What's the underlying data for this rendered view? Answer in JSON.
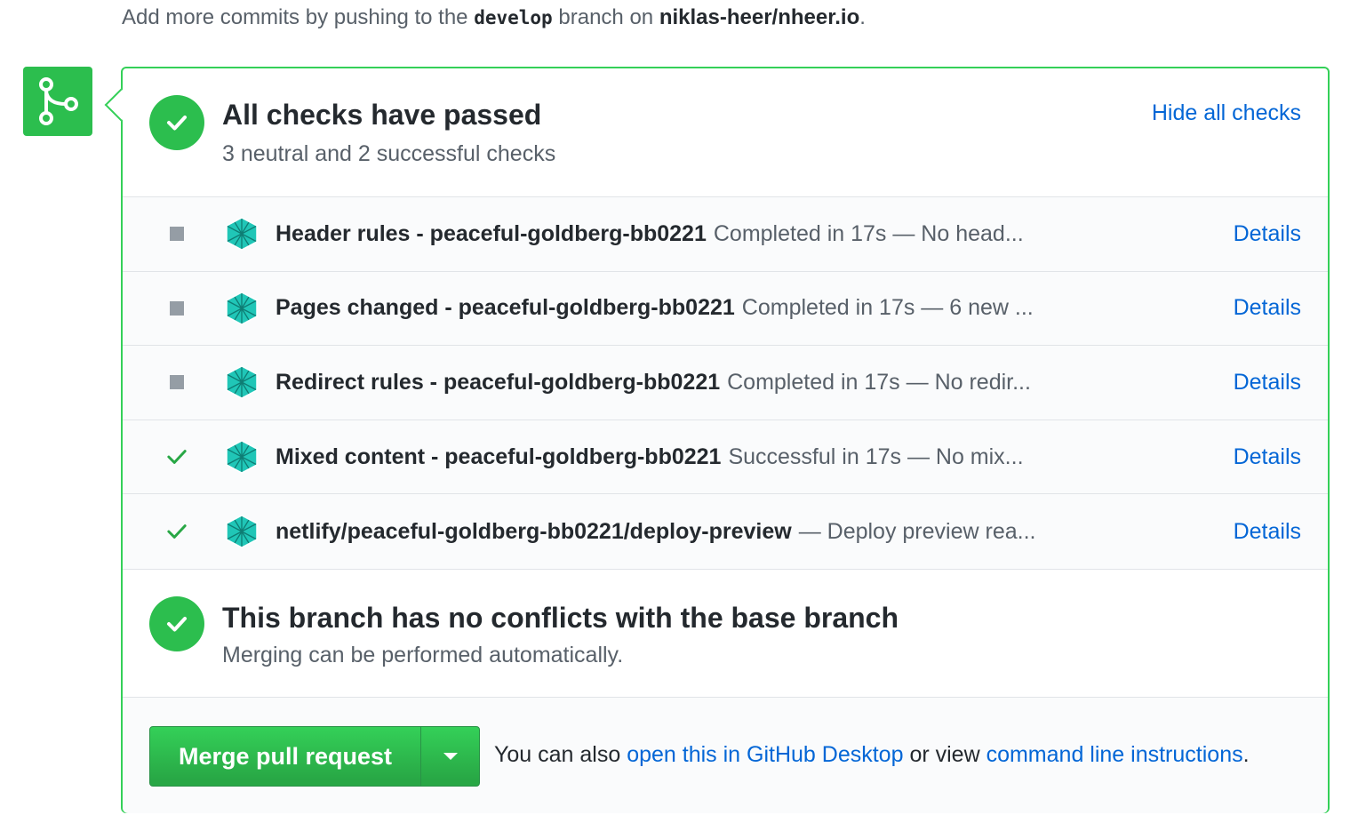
{
  "top_note": {
    "prefix": "Add more commits by pushing to the",
    "branch": "develop",
    "middle": "branch on",
    "repo": "niklas-heer/nheer.io",
    "suffix": "."
  },
  "checks_summary": {
    "title": "All checks have passed",
    "subtitle": "3 neutral and 2 successful checks",
    "hide_link": "Hide all checks"
  },
  "checks": [
    {
      "status": "neutral",
      "name": "Header rules - peaceful-goldberg-bb0221",
      "description": "Completed in 17s — No head...",
      "details": "Details"
    },
    {
      "status": "neutral",
      "name": "Pages changed - peaceful-goldberg-bb0221",
      "description": "Completed in 17s — 6 new ...",
      "details": "Details"
    },
    {
      "status": "neutral",
      "name": "Redirect rules - peaceful-goldberg-bb0221",
      "description": "Completed in 17s — No redir...",
      "details": "Details"
    },
    {
      "status": "success",
      "name": "Mixed content - peaceful-goldberg-bb0221",
      "description": "Successful in 17s — No mix...",
      "details": "Details"
    },
    {
      "status": "success",
      "name": "netlify/peaceful-goldberg-bb0221/deploy-preview",
      "description": "— Deploy preview rea...",
      "details": "Details"
    }
  ],
  "merge_status": {
    "title": "This branch has no conflicts with the base branch",
    "subtitle": "Merging can be performed automatically."
  },
  "merge_footer": {
    "button_label": "Merge pull request",
    "text_prefix": "You can also",
    "desktop_link": "open this in GitHub Desktop",
    "text_middle": "or view",
    "cli_link": "command line instructions",
    "text_suffix": "."
  },
  "colors": {
    "success_green": "#2cbe4e",
    "border_green": "#34d058",
    "link_blue": "#0366d6",
    "neutral_gray": "#959da5"
  }
}
